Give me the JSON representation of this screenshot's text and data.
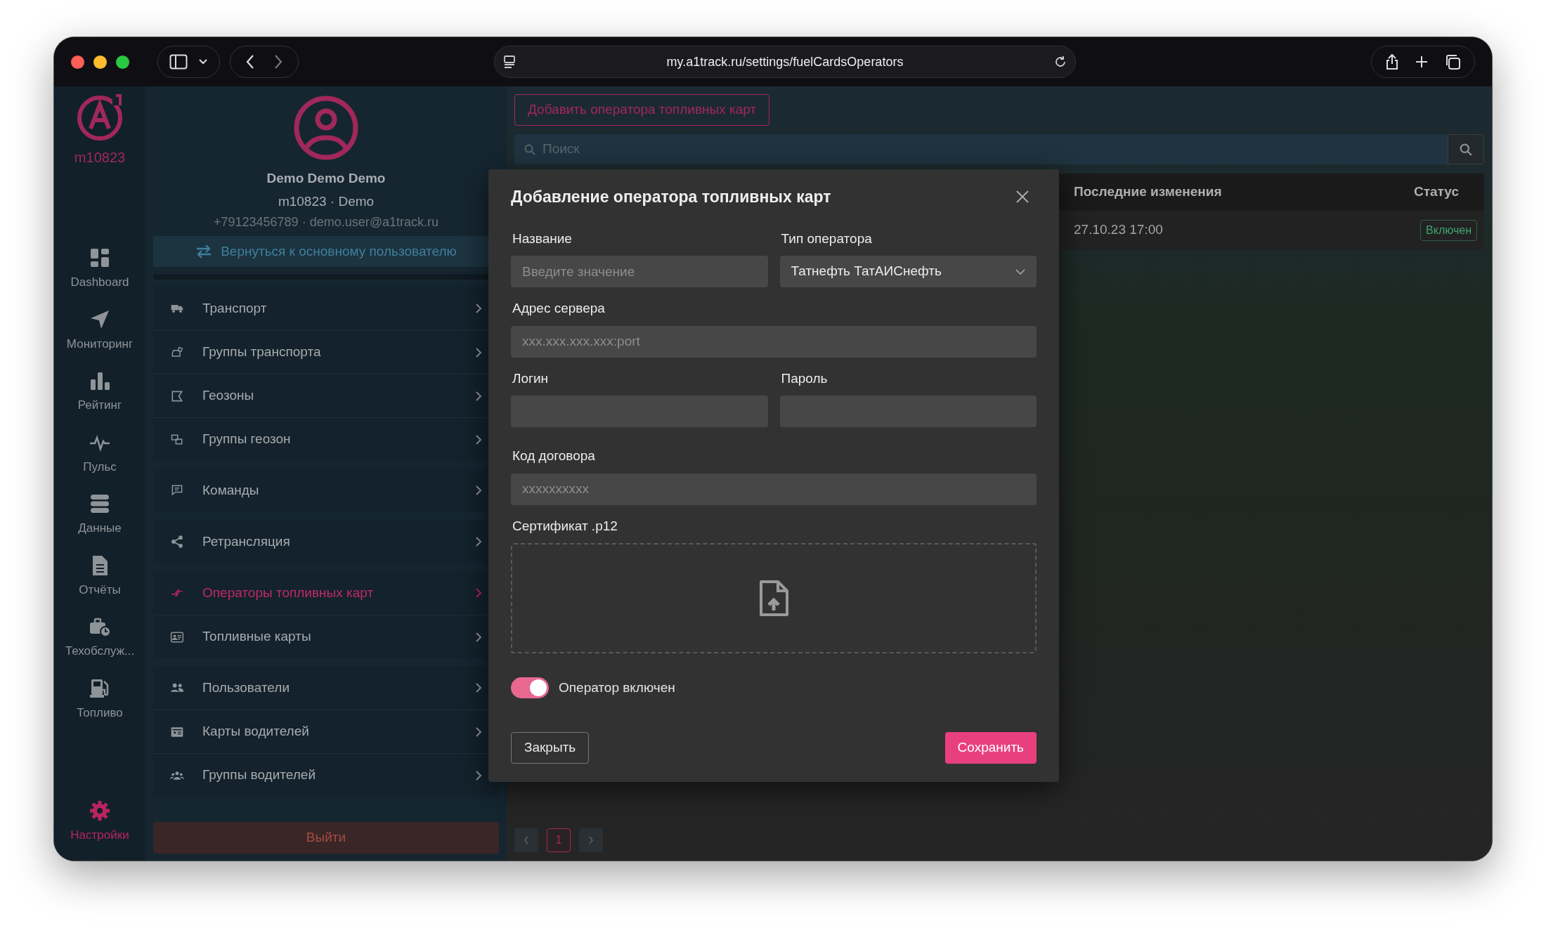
{
  "browser": {
    "url": "my.a1track.ru/settings/fuelCardsOperators"
  },
  "rail": {
    "account": "m10823",
    "items": [
      {
        "label": "Dashboard",
        "selected": false
      },
      {
        "label": "Мониторинг",
        "selected": false
      },
      {
        "label": "Рейтинг",
        "selected": false
      },
      {
        "label": "Пульс",
        "selected": false
      },
      {
        "label": "Данные",
        "selected": false
      },
      {
        "label": "Отчёты",
        "selected": false
      },
      {
        "label": "Техобслуж...",
        "selected": false
      },
      {
        "label": "Топливо",
        "selected": false
      }
    ],
    "bottom_item": {
      "label": "Настройки",
      "selected": true
    }
  },
  "profile": {
    "name": "Demo Demo Demo",
    "account": "m10823 · Demo",
    "contacts": "+79123456789 · demo.user@a1track.ru",
    "switch_back": "Вернуться к основному пользователю"
  },
  "settings_menu": {
    "groups": [
      {
        "items": [
          {
            "label": "Транспорт",
            "selected": false
          },
          {
            "label": "Группы транспорта",
            "selected": false
          },
          {
            "label": "Геозоны",
            "selected": false
          },
          {
            "label": "Группы геозон",
            "selected": false
          }
        ]
      },
      {
        "items": [
          {
            "label": "Команды",
            "selected": false
          }
        ]
      },
      {
        "items": [
          {
            "label": "Ретрансляция",
            "selected": false
          }
        ]
      },
      {
        "items": [
          {
            "label": "Операторы топливных карт",
            "selected": true
          },
          {
            "label": "Топливные карты",
            "selected": false
          }
        ]
      },
      {
        "items": [
          {
            "label": "Пользователи",
            "selected": false
          },
          {
            "label": "Карты водителей",
            "selected": false
          },
          {
            "label": "Группы водителей",
            "selected": false
          }
        ]
      }
    ],
    "logout": "Выйти"
  },
  "toolbar": {
    "add_button": "Добавить оператора топливных карт",
    "search": {
      "placeholder": "Поиск"
    }
  },
  "table": {
    "columns": [
      "Последние изменения",
      "Статус"
    ],
    "rows": [
      {
        "changed": "27.10.23 17:00",
        "status": "Включен"
      }
    ]
  },
  "pagination": {
    "pages": [
      {
        "label": "1",
        "selected": true
      }
    ]
  },
  "dialog": {
    "title": "Добавление оператора топливных карт",
    "rows": [
      {
        "fields": [
          {
            "kind": "text",
            "label": "Название",
            "placeholder": "Введите значение"
          },
          {
            "kind": "select",
            "label": "Тип оператора",
            "value": "Татнефть ТатАИСнефть"
          }
        ]
      },
      {
        "fields": [
          {
            "kind": "text",
            "label": "Адрес сервера",
            "placeholder": "xxx.xxx.xxx.xxx:port"
          }
        ]
      },
      {
        "fields": [
          {
            "kind": "text",
            "label": "Логин"
          },
          {
            "kind": "password",
            "label": "Пароль"
          }
        ]
      },
      {
        "fields": [
          {
            "kind": "text",
            "label": "Код договора",
            "placeholder": "xxxxxxxxxx"
          }
        ]
      }
    ],
    "certificate": {
      "label": "Сертификат .p12"
    },
    "toggle": {
      "label": "Оператор включен",
      "on": true
    },
    "close_button": "Закрыть",
    "save_button": "Сохранить"
  }
}
